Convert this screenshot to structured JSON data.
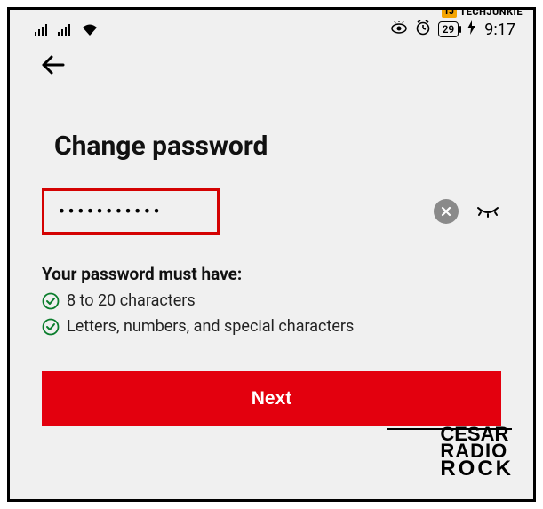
{
  "watermarks": {
    "top_badge": "TJ",
    "top_text": "TECHJUNKIE",
    "bottom_l1": "CESAR",
    "bottom_l2": "RADIO",
    "bottom_l3": "ROCK"
  },
  "statusbar": {
    "battery_level": "29",
    "time": "9:17"
  },
  "header": {
    "title": "Change password"
  },
  "password": {
    "masked": "•••••••••••"
  },
  "requirements": {
    "heading": "Your password must have:",
    "items": [
      "8 to 20 characters",
      "Letters, numbers, and special characters"
    ]
  },
  "actions": {
    "next": "Next"
  }
}
